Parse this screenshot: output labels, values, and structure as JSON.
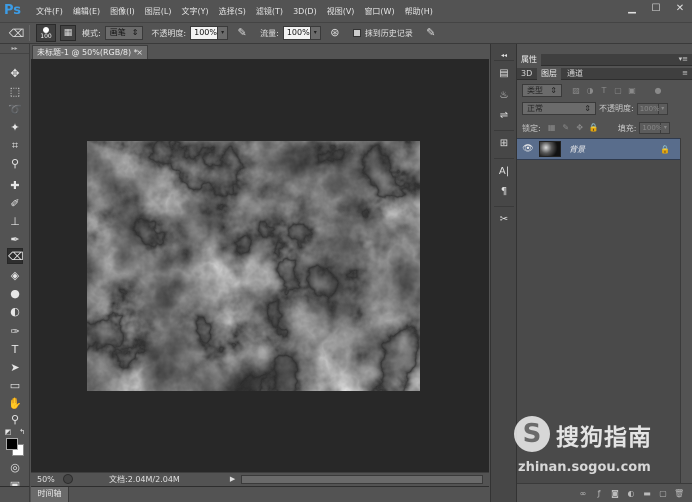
{
  "app": {
    "logo": "Ps"
  },
  "menubar": {
    "items": [
      "文件(F)",
      "编辑(E)",
      "图像(I)",
      "图层(L)",
      "文字(Y)",
      "选择(S)",
      "滤镜(T)",
      "3D(D)",
      "视图(V)",
      "窗口(W)",
      "帮助(H)"
    ],
    "window_controls": [
      "▁",
      "☐",
      "✕"
    ]
  },
  "options": {
    "brush_size": "100",
    "mode_label": "模式:",
    "mode_value": "画笔",
    "opacity_label": "不透明度:",
    "opacity_value": "100%",
    "flow_label": "流量:",
    "flow_value": "100%",
    "history_label": "抹到历史记录"
  },
  "document": {
    "tab_title": "未标题-1 @ 50%(RGB/8) *",
    "tab_close": "×",
    "zoom": "50%",
    "doc_info": "文档:2.04M/2.04M",
    "status_arrow": "▶"
  },
  "timeline": {
    "label": "时间轴"
  },
  "panels": {
    "properties_tab": "属性",
    "tabs": [
      "3D",
      "图层",
      "通道"
    ],
    "filter_kind": "类型",
    "blend_mode": "正常",
    "opacity_label": "不透明度:",
    "opacity_value": "100%",
    "lock_label": "锁定:",
    "fill_label": "填充:",
    "fill_value": "100%",
    "layer_name": "背景"
  },
  "watermark": {
    "logo_letter": "S",
    "brand": "搜狗指南",
    "url": "zhinan.sogou.com"
  }
}
